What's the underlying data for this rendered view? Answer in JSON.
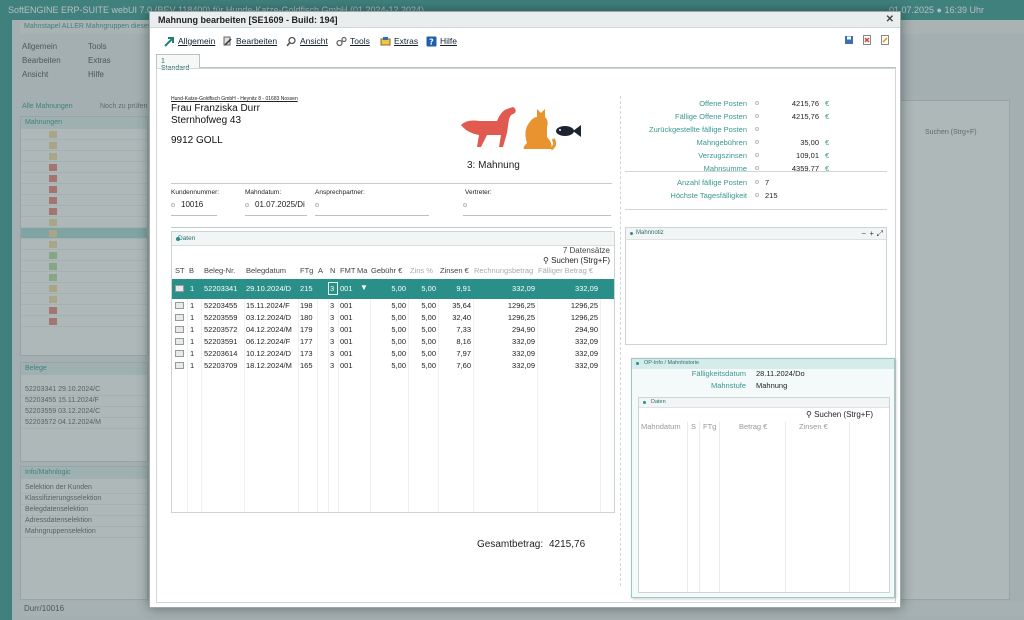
{
  "background": {
    "app_title": "SoftENGINE ERP-SUITE webUI 7.0 (BEV 118400) für Hunde-Katze-Goldfisch GmbH (01.2024-12.2024)",
    "app_time": "01.07.2025 ● 16:39 Uhr",
    "breadcrumb": "Mahnstapel ALLER Mahngruppen dieses Unt",
    "toolbar": {
      "allgemein": "Allgemein",
      "tools": "Tools",
      "bearbeiten": "Bearbeiten",
      "extras": "Extras",
      "ansicht": "Ansicht",
      "hilfe": "Hilfe"
    },
    "tab_alle": "Alle Mahnungen",
    "tab_pruef": "Noch zu prüfen",
    "panel_title": "Mahnungen",
    "belege_title": "Belege",
    "belege_rows": [
      "52203341 29.10.2024/C",
      "52203455 15.11.2024/F",
      "52203559 03.12.2024/C",
      "52203572 04.12.2024/M"
    ],
    "info_title": "Info/Mahnlogic",
    "info_rows": [
      "Selektion der Kunden",
      "Klassifizierungsselektion",
      "Belegdatenselektion",
      "Adressdatenselektion",
      "Mahngruppenselektion"
    ],
    "search": "Suchen (Strg+F)",
    "status": "Durr/10016"
  },
  "dialog": {
    "title": "Mahnung bearbeiten [SE1609 - Build: 194]",
    "menu": {
      "allgemein": "Allgemein",
      "bearbeiten": "Bearbeiten",
      "ansicht": "Ansicht",
      "tools": "Tools",
      "extras": "Extras",
      "hilfe": "Hilfe"
    },
    "tab": "1 Standard"
  },
  "letter": {
    "sender": "Hund-Katze-Goldfisch GmbH - Heynitz 8 - 01683 Nossen",
    "recipient_name": "Frau Franziska Durr",
    "recipient_street": "Sternhofweg 43",
    "recipient_city": "9912 GOLL",
    "title": "3: Mahnung",
    "kundennummer_label": "Kundennummer:",
    "kundennummer": "10016",
    "mahndatum_label": "Mahndatum:",
    "mahndatum": "01.07.2025/Di",
    "ansprechpartner_label": "Ansprechpartner:",
    "vertreter_label": "Vertreter:"
  },
  "grid": {
    "title": "Daten",
    "count": "7 Datensätze",
    "search": "Suchen (Strg+F)",
    "columns": [
      "ST",
      "B",
      "Beleg-Nr.",
      "Belegdatum",
      "FTg",
      "A",
      "N",
      "FMT",
      "Ma",
      "Gebühr €",
      "Zins %",
      "Zinsen €",
      "Rechnungsbetrag",
      "Fälliger Betrag €"
    ],
    "rows": [
      {
        "b": "1",
        "nr": "52203341",
        "datum": "29.10.2024/D",
        "ftg": "215",
        "n": "3",
        "fmt": "001",
        "gebuehr": "5,00",
        "zins": "5,00",
        "zinsen": "9,91",
        "rechnung": "332,09",
        "faellig": "332,09"
      },
      {
        "b": "1",
        "nr": "52203455",
        "datum": "15.11.2024/F",
        "ftg": "198",
        "n": "3",
        "fmt": "001",
        "gebuehr": "5,00",
        "zins": "5,00",
        "zinsen": "35,64",
        "rechnung": "1296,25",
        "faellig": "1296,25"
      },
      {
        "b": "1",
        "nr": "52203559",
        "datum": "03.12.2024/D",
        "ftg": "180",
        "n": "3",
        "fmt": "001",
        "gebuehr": "5,00",
        "zins": "5,00",
        "zinsen": "32,40",
        "rechnung": "1296,25",
        "faellig": "1296,25"
      },
      {
        "b": "1",
        "nr": "52203572",
        "datum": "04.12.2024/M",
        "ftg": "179",
        "n": "3",
        "fmt": "001",
        "gebuehr": "5,00",
        "zins": "5,00",
        "zinsen": "7,33",
        "rechnung": "294,90",
        "faellig": "294,90"
      },
      {
        "b": "1",
        "nr": "52203591",
        "datum": "06.12.2024/F",
        "ftg": "177",
        "n": "3",
        "fmt": "001",
        "gebuehr": "5,00",
        "zins": "5,00",
        "zinsen": "8,16",
        "rechnung": "332,09",
        "faellig": "332,09"
      },
      {
        "b": "1",
        "nr": "52203614",
        "datum": "10.12.2024/D",
        "ftg": "173",
        "n": "3",
        "fmt": "001",
        "gebuehr": "5,00",
        "zins": "5,00",
        "zinsen": "7,97",
        "rechnung": "332,09",
        "faellig": "332,09"
      },
      {
        "b": "1",
        "nr": "52203709",
        "datum": "18.12.2024/M",
        "ftg": "165",
        "n": "3",
        "fmt": "001",
        "gebuehr": "5,00",
        "zins": "5,00",
        "zinsen": "7,60",
        "rechnung": "332,09",
        "faellig": "332,09"
      }
    ],
    "total_label": "Gesamtbetrag:",
    "total_value": "4215,76"
  },
  "summary": {
    "items": [
      {
        "label": "Offene Posten",
        "value": "4215,76",
        "cur": "€"
      },
      {
        "label": "Fällige Offene Posten",
        "value": "4215,76",
        "cur": "€"
      },
      {
        "label": "Zurückgestellte fällige Posten",
        "value": "",
        "cur": ""
      },
      {
        "label": "Mahngebühren",
        "value": "35,00",
        "cur": "€"
      },
      {
        "label": "Verzugszinsen",
        "value": "109,01",
        "cur": "€"
      },
      {
        "label": "Mahnsumme",
        "value": "4359,77",
        "cur": "€"
      }
    ],
    "anzahl_label": "Anzahl fällige Posten",
    "anzahl_value": "7",
    "hoechste_label": "Höchste Tagesfälligkeit",
    "hoechste_value": "215"
  },
  "note": {
    "title": "Mahnnotiz"
  },
  "opinfo": {
    "title": "OP-Info / Mahnhistorie",
    "faellig_label": "Fälligkeitsdatum",
    "faellig_value": "28.11.2024/Do",
    "stufe_label": "Mahnstufe",
    "stufe_value": "Mahnung",
    "grid_title": "Daten",
    "search": "Suchen (Strg+F)",
    "columns": [
      "Mahndatum",
      "S",
      "FTg",
      "Betrag €",
      "Zinsen €"
    ]
  },
  "colors": {
    "accent": "#2a8f88",
    "label": "#3a9690",
    "dog": "#e05a4f",
    "cat": "#e8932e",
    "fish": "#1b2430"
  }
}
